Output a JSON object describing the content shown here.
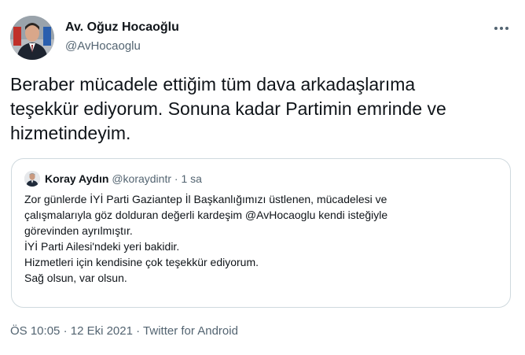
{
  "tweet": {
    "author_name": "Av. Oğuz Hocaoğlu",
    "author_handle": "@AvHocaoglu",
    "more_icon": "more-horizontal-icon",
    "text": "Beraber mücadele ettiğim tüm dava arkadaşlarıma\nteşekkür ediyorum. Sonuna kadar Partimin emrinde ve\nhizmetindeyim.",
    "time": "ÖS 10:05",
    "separator": "·",
    "date": "12 Eki 2021",
    "source": "Twitter for Android"
  },
  "quote": {
    "author_name": "Koray Aydın",
    "author_handle": "@koraydintr",
    "separator": "·",
    "time_ago": "1 sa",
    "lines": [
      "Zor günlerde İYİ Parti Gaziantep İl Başkanlığımızı üstlenen, mücadelesi ve",
      "çalışmalarıyla göz dolduran değerli kardeşim @AvHocaoglu kendi isteğiyle",
      "görevinden ayrılmıştır.",
      "İYİ Parti Ailesi'ndeki yeri bakidir.",
      "Hizmetleri için kendisine çok teşekkür ediyorum.",
      "Sağ olsun, var olsun."
    ]
  },
  "colors": {
    "primary_text": "#0f1419",
    "secondary_text": "#536471",
    "border": "#cfd9de",
    "background": "#ffffff"
  }
}
